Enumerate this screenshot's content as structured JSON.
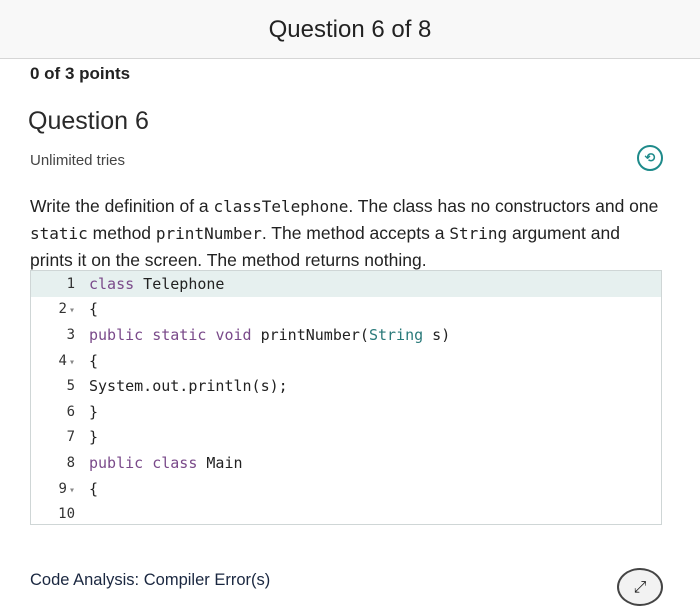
{
  "header": {
    "title": "Question 6 of 8"
  },
  "score": {
    "text": "0 of 3 points"
  },
  "question": {
    "heading": "Question 6",
    "tries": "Unlimited tries",
    "prompt_parts": [
      "Write the definition of a ",
      "classTelephone",
      ". The class has no constructors and one ",
      "static",
      " method ",
      "printNumber",
      ". The method accepts a ",
      "String",
      " argument and prints it on the screen. The method returns nothing."
    ]
  },
  "editor": {
    "lines": [
      {
        "num": "1",
        "fold": "",
        "code": "class Telephone"
      },
      {
        "num": "2",
        "fold": "▾",
        "code": "{"
      },
      {
        "num": "3",
        "fold": "",
        "code": "public static void printNumber(String s)"
      },
      {
        "num": "4",
        "fold": "▾",
        "code": "{"
      },
      {
        "num": "5",
        "fold": "",
        "code": "System.out.println(s);"
      },
      {
        "num": "6",
        "fold": "",
        "code": "}"
      },
      {
        "num": "7",
        "fold": "",
        "code": "}"
      },
      {
        "num": "8",
        "fold": "",
        "code": "public class Main"
      },
      {
        "num": "9",
        "fold": "▾",
        "code": "{"
      },
      {
        "num": "10",
        "fold": "",
        "code": ""
      }
    ]
  },
  "analysis": {
    "label": "Code Analysis: Compiler Error(s)"
  },
  "icons": {
    "history": "history-icon",
    "expand": "expand-icon"
  }
}
